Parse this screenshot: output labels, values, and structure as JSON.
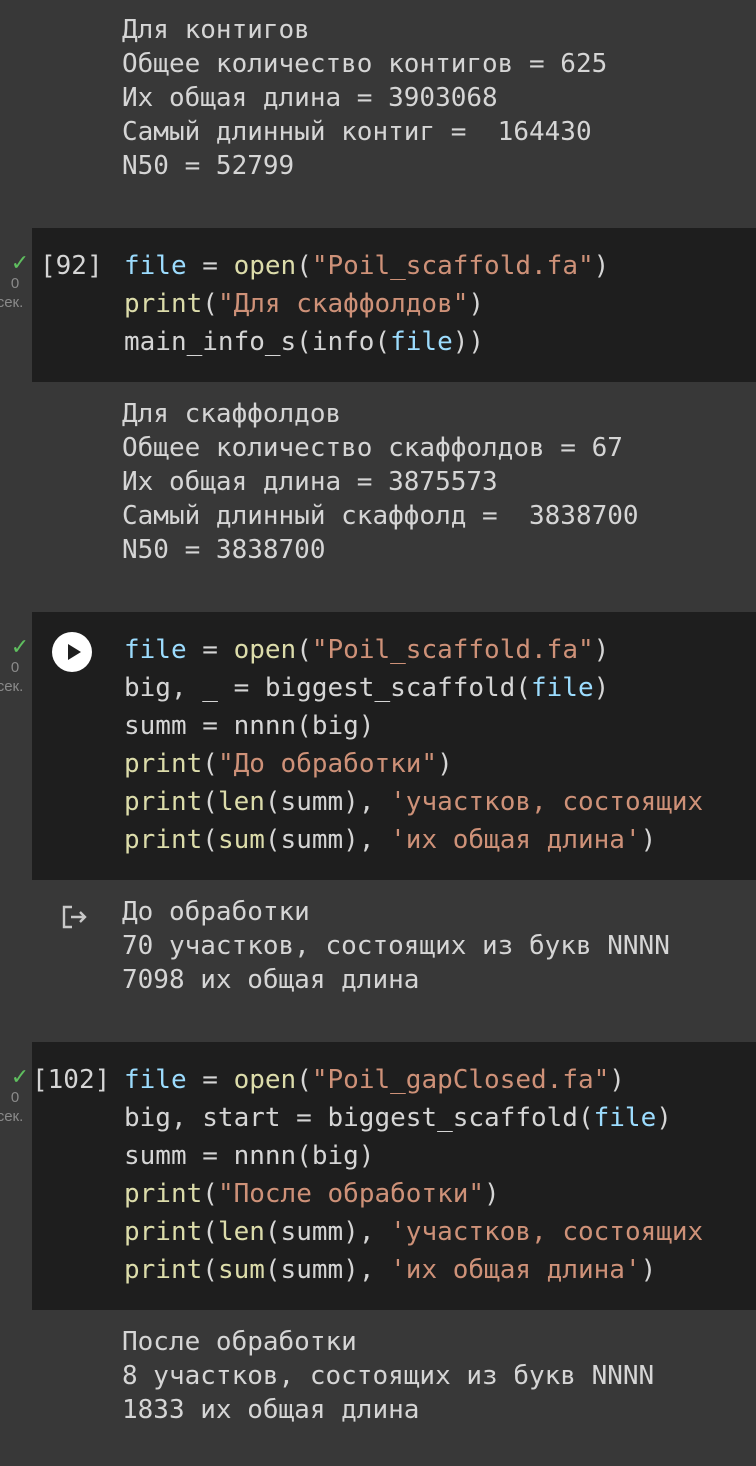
{
  "outputs": {
    "contigs": "Для контигов\nОбщее количество контигов = 625\nИх общая длина = 3903068\nСамый длинный контиг =  164430\nN50 = 52799",
    "scaffolds": "Для скаффолдов\nОбщее количество скаффолдов = 67\nИх общая длина = 3875573\nСамый длинный скаффолд =  3838700\nN50 = 3838700",
    "before": "До обработки\n70 участков, состоящих из букв NNNN\n7098 их общая длина",
    "after": "После обработки\n8 участков, состоящих из букв NNNN\n1833 их общая длина"
  },
  "cells": [
    {
      "exec_count": "[92]",
      "status_time": "0",
      "status_unit": "сек.",
      "lines": [
        [
          [
            "var",
            "file"
          ],
          [
            "p",
            " = "
          ],
          [
            "kw",
            "open"
          ],
          [
            "p",
            "("
          ],
          [
            "str",
            "\"Poil_scaffold.fa\""
          ],
          [
            "p",
            ")"
          ]
        ],
        [
          [
            "kw",
            "print"
          ],
          [
            "p",
            "("
          ],
          [
            "str",
            "\"Для скаффолдов\""
          ],
          [
            "p",
            ")"
          ]
        ],
        [
          [
            "p",
            "main_info_s(info("
          ],
          [
            "var",
            "file"
          ],
          [
            "p",
            "))"
          ]
        ]
      ]
    },
    {
      "exec_count": "",
      "status_time": "0",
      "status_unit": "сек.",
      "lines": [
        [
          [
            "var",
            "file"
          ],
          [
            "p",
            " = "
          ],
          [
            "kw",
            "open"
          ],
          [
            "p",
            "("
          ],
          [
            "str",
            "\"Poil_scaffold.fa\""
          ],
          [
            "p",
            ")"
          ]
        ],
        [
          [
            "p",
            "big, _ = biggest_scaffold("
          ],
          [
            "var",
            "file"
          ],
          [
            "p",
            ")"
          ]
        ],
        [
          [
            "p",
            "summ = nnnn(big)"
          ]
        ],
        [
          [
            "kw",
            "print"
          ],
          [
            "p",
            "("
          ],
          [
            "str",
            "\"До обработки\""
          ],
          [
            "p",
            ")"
          ]
        ],
        [
          [
            "kw",
            "print"
          ],
          [
            "p",
            "("
          ],
          [
            "kw",
            "len"
          ],
          [
            "p",
            "(summ), "
          ],
          [
            "str",
            "'участков, состоящих"
          ]
        ],
        [
          [
            "kw",
            "print"
          ],
          [
            "p",
            "("
          ],
          [
            "kw",
            "sum"
          ],
          [
            "p",
            "(summ), "
          ],
          [
            "str",
            "'их общая длина'"
          ],
          [
            "p",
            ")"
          ]
        ]
      ]
    },
    {
      "exec_count": "[102]",
      "status_time": "0",
      "status_unit": "сек.",
      "lines": [
        [
          [
            "var",
            "file"
          ],
          [
            "p",
            " = "
          ],
          [
            "kw",
            "open"
          ],
          [
            "p",
            "("
          ],
          [
            "str",
            "\"Poil_gapClosed.fa\""
          ],
          [
            "p",
            ")"
          ]
        ],
        [
          [
            "p",
            "big, start = biggest_scaffold("
          ],
          [
            "var",
            "file"
          ],
          [
            "p",
            ")"
          ]
        ],
        [
          [
            "p",
            "summ = nnnn(big)"
          ]
        ],
        [
          [
            "kw",
            "print"
          ],
          [
            "p",
            "("
          ],
          [
            "str",
            "\"После обработки\""
          ],
          [
            "p",
            ")"
          ]
        ],
        [
          [
            "kw",
            "print"
          ],
          [
            "p",
            "("
          ],
          [
            "kw",
            "len"
          ],
          [
            "p",
            "(summ), "
          ],
          [
            "str",
            "'участков, состоящих"
          ]
        ],
        [
          [
            "kw",
            "print"
          ],
          [
            "p",
            "("
          ],
          [
            "kw",
            "sum"
          ],
          [
            "p",
            "(summ), "
          ],
          [
            "str",
            "'их общая длина'"
          ],
          [
            "p",
            ")"
          ]
        ]
      ]
    }
  ]
}
